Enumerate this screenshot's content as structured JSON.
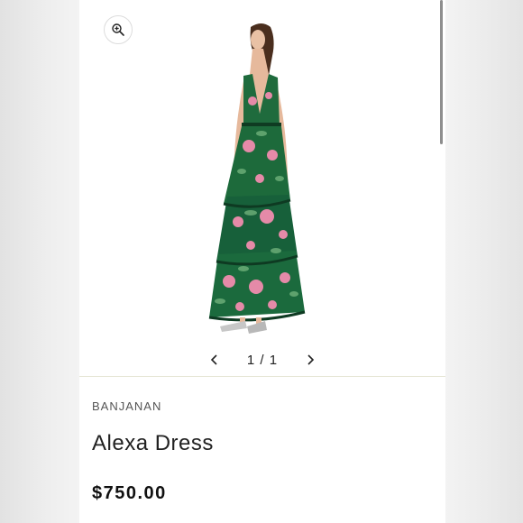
{
  "gallery": {
    "zoom_icon": "zoom-in-icon",
    "prev_icon": "chevron-left-icon",
    "next_icon": "chevron-right-icon",
    "counter": "1 / 1",
    "dress_colors": {
      "base": "#1f6b3d",
      "dark": "#0f3b22",
      "pink": "#e58aa8",
      "light_green": "#6fb07a"
    }
  },
  "product": {
    "brand": "BANJANAN",
    "name": "Alexa Dress",
    "price": "$750.00"
  }
}
